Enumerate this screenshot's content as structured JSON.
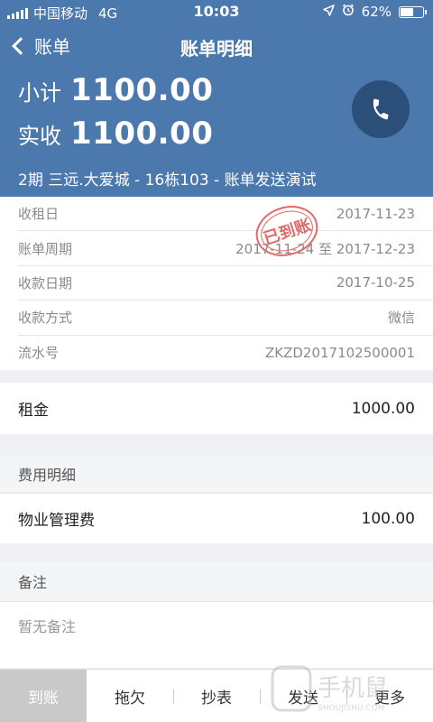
{
  "status": {
    "carrier": "中国移动",
    "network": "4G",
    "time": "10:03",
    "battery": "62%",
    "battery_level": 0.62
  },
  "nav": {
    "back_label": "账单",
    "title": "账单明细"
  },
  "summary": {
    "subtotal_label": "小计",
    "subtotal_value": "1100.00",
    "received_label": "实收",
    "received_value": "1100.00",
    "subtitle": "2期 三远.大爱城 - 16栋103 - 账单发送演试"
  },
  "info_rows": [
    {
      "label": "收租日",
      "value": "2017-11-23"
    },
    {
      "label": "账单周期",
      "value": "2017-11-24 至 2017-12-23"
    },
    {
      "label": "收款日期",
      "value": "2017-10-25"
    },
    {
      "label": "收款方式",
      "value": "微信"
    },
    {
      "label": "流水号",
      "value": "ZKZD2017102500001"
    }
  ],
  "stamp": {
    "text": "已到账"
  },
  "rent": {
    "label": "租金",
    "value": "1000.00"
  },
  "fees": {
    "title": "费用明细",
    "items": [
      {
        "label": "物业管理费",
        "value": "100.00"
      }
    ]
  },
  "remark": {
    "title": "备注",
    "content": "暂无备注"
  },
  "tabs": [
    {
      "label": "到账"
    },
    {
      "label": "拖欠"
    },
    {
      "label": "抄表"
    },
    {
      "label": "发送"
    },
    {
      "label": "更多"
    }
  ],
  "watermark": {
    "text": "手机鼠",
    "subtext": "SHOUJISHU.COM"
  },
  "colors": {
    "header": "#4b78ad",
    "phone_button": "#2c4f79",
    "stamp": "#e06a6a",
    "tab_active": "#c9c9c9"
  },
  "icons": {
    "back": "chevron-left-icon",
    "phone": "phone-icon",
    "location": "location-arrow-icon",
    "alarm": "alarm-icon"
  }
}
